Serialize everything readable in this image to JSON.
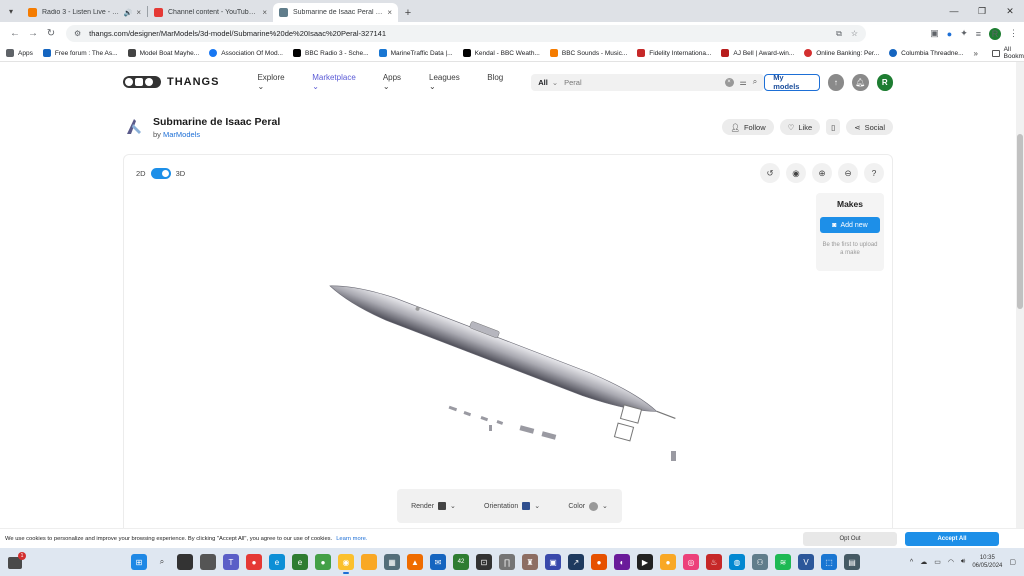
{
  "browser": {
    "tabs": [
      {
        "title": "Radio 3 - Listen Live - BBC",
        "favicon_color": "#f57c00",
        "audio": true,
        "active": false
      },
      {
        "title": "Channel content - YouTube Stu",
        "favicon_color": "#e53935",
        "audio": false,
        "active": false
      },
      {
        "title": "Submarine de Isaac Peral - 3D",
        "favicon_color": "#607d8b",
        "audio": false,
        "active": true
      }
    ],
    "url": "thangs.com/designer/MarModels/3d-model/Submarine%20de%20Isaac%20Peral-327141",
    "profile_initial": "R",
    "bookmarks": [
      {
        "label": "Apps",
        "color": "#5f6368"
      },
      {
        "label": "Free forum : The As...",
        "color": "#1565c0"
      },
      {
        "label": "Model Boat Mayhe...",
        "color": "#444444"
      },
      {
        "label": "Association Of Mod...",
        "color": "#1877f2"
      },
      {
        "label": "BBC Radio 3 - Sche...",
        "color": "#000000"
      },
      {
        "label": "MarineTraffic Data |...",
        "color": "#1976d2"
      },
      {
        "label": "Kendal - BBC Weath...",
        "color": "#000000"
      },
      {
        "label": "BBC Sounds - Music...",
        "color": "#f57c00"
      },
      {
        "label": "Fidelity Internationa...",
        "color": "#c62828"
      },
      {
        "label": "AJ Bell | Award-win...",
        "color": "#b71c1c"
      },
      {
        "label": "Online Banking: Per...",
        "color": "#d32f2f"
      },
      {
        "label": "Columbia Threadne...",
        "color": "#1565c0"
      }
    ],
    "all_bookmarks": "All Bookmarks"
  },
  "site": {
    "logo": "THANGS",
    "nav": [
      "Explore",
      "Marketplace",
      "Apps",
      "Leagues",
      "Blog"
    ],
    "active_nav": "Marketplace",
    "search": {
      "scope": "All",
      "query": "Peral"
    },
    "my_models": "My models",
    "user_initial": "R",
    "accent": "#1d8fe8"
  },
  "model": {
    "title": "Submarine de Isaac Peral",
    "by_prefix": "by",
    "author": "MarModels",
    "actions": {
      "follow": "Follow",
      "like": "Like",
      "social": "Social"
    }
  },
  "viewer": {
    "toggle_2d": "2D",
    "toggle_3d": "3D",
    "makes_title": "Makes",
    "add_new": "Add new",
    "makes_hint": "Be the first to upload a make",
    "render": "Render",
    "orientation": "Orientation",
    "color": "Color"
  },
  "cookie": {
    "text": "We use cookies to personalize and improve your browsing experience. By clicking \"Accept All\", you agree to our use of cookies.",
    "learn_more": "Learn more.",
    "opt_out": "Opt Out",
    "accept": "Accept All"
  },
  "taskbar": {
    "notification_count": "1",
    "badge_42": "42",
    "time": "10:35",
    "date": "06/05/2024"
  }
}
